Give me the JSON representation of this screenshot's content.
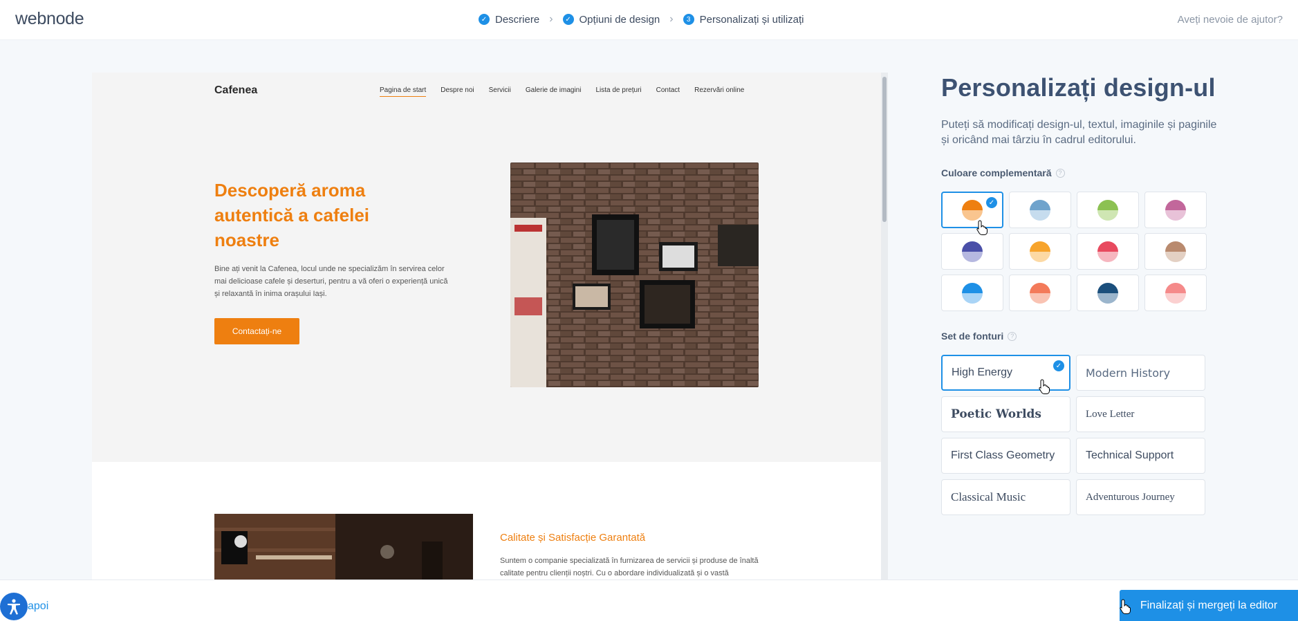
{
  "brand": "webnode",
  "steps": [
    {
      "label": "Descriere",
      "marker": "✓"
    },
    {
      "label": "Opțiuni de design",
      "marker": "✓"
    },
    {
      "label": "Personalizați și utilizați",
      "marker": "3"
    }
  ],
  "help": "Aveți nevoie de ajutor?",
  "preview": {
    "site_name": "Cafenea",
    "nav": [
      "Pagina de start",
      "Despre noi",
      "Servicii",
      "Galerie de imagini",
      "Lista de prețuri",
      "Contact",
      "Rezervări online"
    ],
    "hero_title": "Descoperă aroma autentică a cafelei noastre",
    "hero_text": "Bine ați venit la Cafenea, locul unde ne specializăm în servirea celor mai delicioase cafele și deserturi, pentru a vă oferi o experiență unică și relaxantă în inima orașului Iași.",
    "hero_button": "Contactați-ne",
    "section_title": "Calitate și Satisfacție Garantată",
    "section_text": "Suntem o companie specializată în furnizarea de servicii și produse de înaltă calitate pentru clienții noștri. Cu o abordare individualizată și o vastă"
  },
  "panel": {
    "title": "Personalizați design-ul",
    "description": "Puteți să modificați design-ul, textul, imaginile și paginile și oricând mai târziu în cadrul editorului.",
    "color_label": "Culoare complementară",
    "font_label": "Set de fonturi",
    "info_glyph": "?",
    "check_glyph": "✓",
    "colors": [
      {
        "top": "#ee7f10",
        "bottom": "#f9c58f",
        "selected": true
      },
      {
        "top": "#6fa3cc",
        "bottom": "#c6dcee",
        "selected": false
      },
      {
        "top": "#8cc152",
        "bottom": "#cfe6b3",
        "selected": false
      },
      {
        "top": "#c2679b",
        "bottom": "#e8c2d8",
        "selected": false
      },
      {
        "top": "#4a4fa8",
        "bottom": "#b6b8e0",
        "selected": false
      },
      {
        "top": "#f7a42c",
        "bottom": "#fcd9a4",
        "selected": false
      },
      {
        "top": "#e84a5f",
        "bottom": "#f6b6bf",
        "selected": false
      },
      {
        "top": "#b98a6e",
        "bottom": "#e3d0c3",
        "selected": false
      },
      {
        "top": "#1e90e6",
        "bottom": "#a9d4f6",
        "selected": false
      },
      {
        "top": "#f37a5a",
        "bottom": "#f9c3b3",
        "selected": false
      },
      {
        "top": "#1b4f7c",
        "bottom": "#9bb5cc",
        "selected": false
      },
      {
        "top": "#f58a8a",
        "bottom": "#fbd0d0",
        "selected": false
      }
    ],
    "fonts": [
      {
        "label": "High Energy",
        "selected": true,
        "style": "sans"
      },
      {
        "label": "Modern History",
        "selected": false,
        "style": "sans-light"
      },
      {
        "label": "Poetic Worlds",
        "selected": false,
        "style": "serif-bold"
      },
      {
        "label": "Love Letter",
        "selected": false,
        "style": "serif-small"
      },
      {
        "label": "First Class Geometry",
        "selected": false,
        "style": "sans"
      },
      {
        "label": "Technical Support",
        "selected": false,
        "style": "sans"
      },
      {
        "label": "Classical Music",
        "selected": false,
        "style": "serif"
      },
      {
        "label": "Adventurous Journey",
        "selected": false,
        "style": "serif-small"
      }
    ]
  },
  "footer": {
    "back": "Înapoi",
    "back_visible": "apoi",
    "finish": "Finalizați și mergeți la editor"
  }
}
